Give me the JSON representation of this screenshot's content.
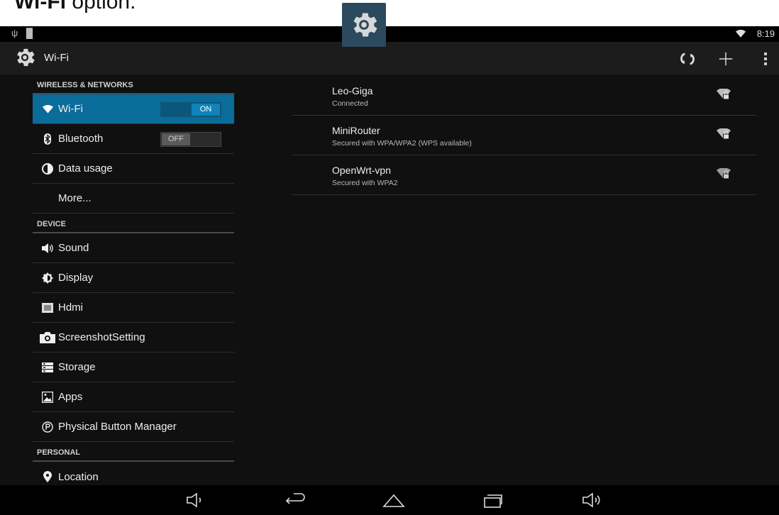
{
  "caption": {
    "bold": "Wi-Fi",
    "rest": " option."
  },
  "statusbar": {
    "time": "8:19",
    "left_icons": [
      "usb-icon",
      "sd-card-icon"
    ],
    "right_icons": [
      "wifi-status-icon"
    ]
  },
  "actionbar": {
    "title": "Wi-Fi",
    "actions": [
      "wps-icon",
      "add-network-icon",
      "overflow-menu-icon"
    ]
  },
  "sidebar": {
    "sections": [
      {
        "title": "WIRELESS & NETWORKS"
      },
      {
        "title": "DEVICE"
      },
      {
        "title": "PERSONAL"
      }
    ],
    "items": [
      {
        "label": "Wi-Fi",
        "icon": "wifi-icon",
        "toggle": "ON",
        "selected": true
      },
      {
        "label": "Bluetooth",
        "icon": "bluetooth-icon",
        "toggle": "OFF"
      },
      {
        "label": "Data usage",
        "icon": "data-usage-icon"
      },
      {
        "label": "More..."
      },
      {
        "label": "Sound",
        "icon": "sound-icon"
      },
      {
        "label": "Display",
        "icon": "display-icon"
      },
      {
        "label": "Hdmi",
        "icon": "hdmi-icon"
      },
      {
        "label": "ScreenshotSetting",
        "icon": "camera-icon"
      },
      {
        "label": "Storage",
        "icon": "storage-icon"
      },
      {
        "label": "Apps",
        "icon": "apps-icon"
      },
      {
        "label": "Physical Button Manager",
        "icon": "physical-button-icon"
      },
      {
        "label": "Location",
        "icon": "location-icon"
      }
    ]
  },
  "networks": [
    {
      "ssid": "Leo-Giga",
      "summary": "Connected",
      "signal": "wifi-lock-icon"
    },
    {
      "ssid": "MiniRouter",
      "summary": "Secured with WPA/WPA2 (WPS available)",
      "signal": "wifi-lock-icon"
    },
    {
      "ssid": "OpenWrt-vpn",
      "summary": "Secured with WPA2",
      "signal": "wifi-lock-icon"
    }
  ],
  "navbar": [
    "volume-down-icon",
    "back-icon",
    "home-icon",
    "recents-icon",
    "volume-up-icon"
  ],
  "colors": {
    "accent": "#0a6c99",
    "toggle_on": "#0f84b8",
    "background": "#101010"
  }
}
